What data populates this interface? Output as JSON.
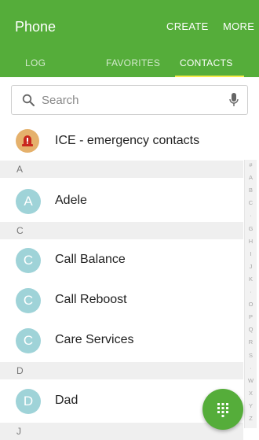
{
  "app_title": "Phone",
  "actions": {
    "create": "CREATE",
    "more": "MORE"
  },
  "tabs": [
    "LOG",
    "FAVORITES",
    "CONTACTS"
  ],
  "active_tab": "CONTACTS",
  "search": {
    "placeholder": "Search"
  },
  "ice": {
    "label": "ICE - emergency contacts",
    "icon": "warning-siren-icon"
  },
  "sections": [
    {
      "letter": "A",
      "contacts": [
        {
          "initial": "A",
          "name": "Adele"
        }
      ]
    },
    {
      "letter": "C",
      "contacts": [
        {
          "initial": "C",
          "name": "Call Balance"
        },
        {
          "initial": "C",
          "name": "Call Reboost"
        },
        {
          "initial": "C",
          "name": "Care Services"
        }
      ]
    },
    {
      "letter": "D",
      "contacts": [
        {
          "initial": "D",
          "name": "Dad"
        }
      ]
    },
    {
      "letter": "J",
      "contacts": []
    }
  ],
  "index_letters": [
    "#",
    "A",
    "B",
    "C",
    "·",
    "G",
    "H",
    "I",
    "J",
    "K",
    "·",
    "O",
    "P",
    "Q",
    "R",
    "S",
    "·",
    "W",
    "X",
    "Y",
    "Z"
  ],
  "fab_icon": "dialpad-icon",
  "colors": {
    "brand_green": "#55ad3a",
    "tab_indicator": "#f7ec4b",
    "avatar_bg": "#9fd3d8",
    "ice_bg": "#e5b16c",
    "ice_icon": "#c8281e"
  }
}
